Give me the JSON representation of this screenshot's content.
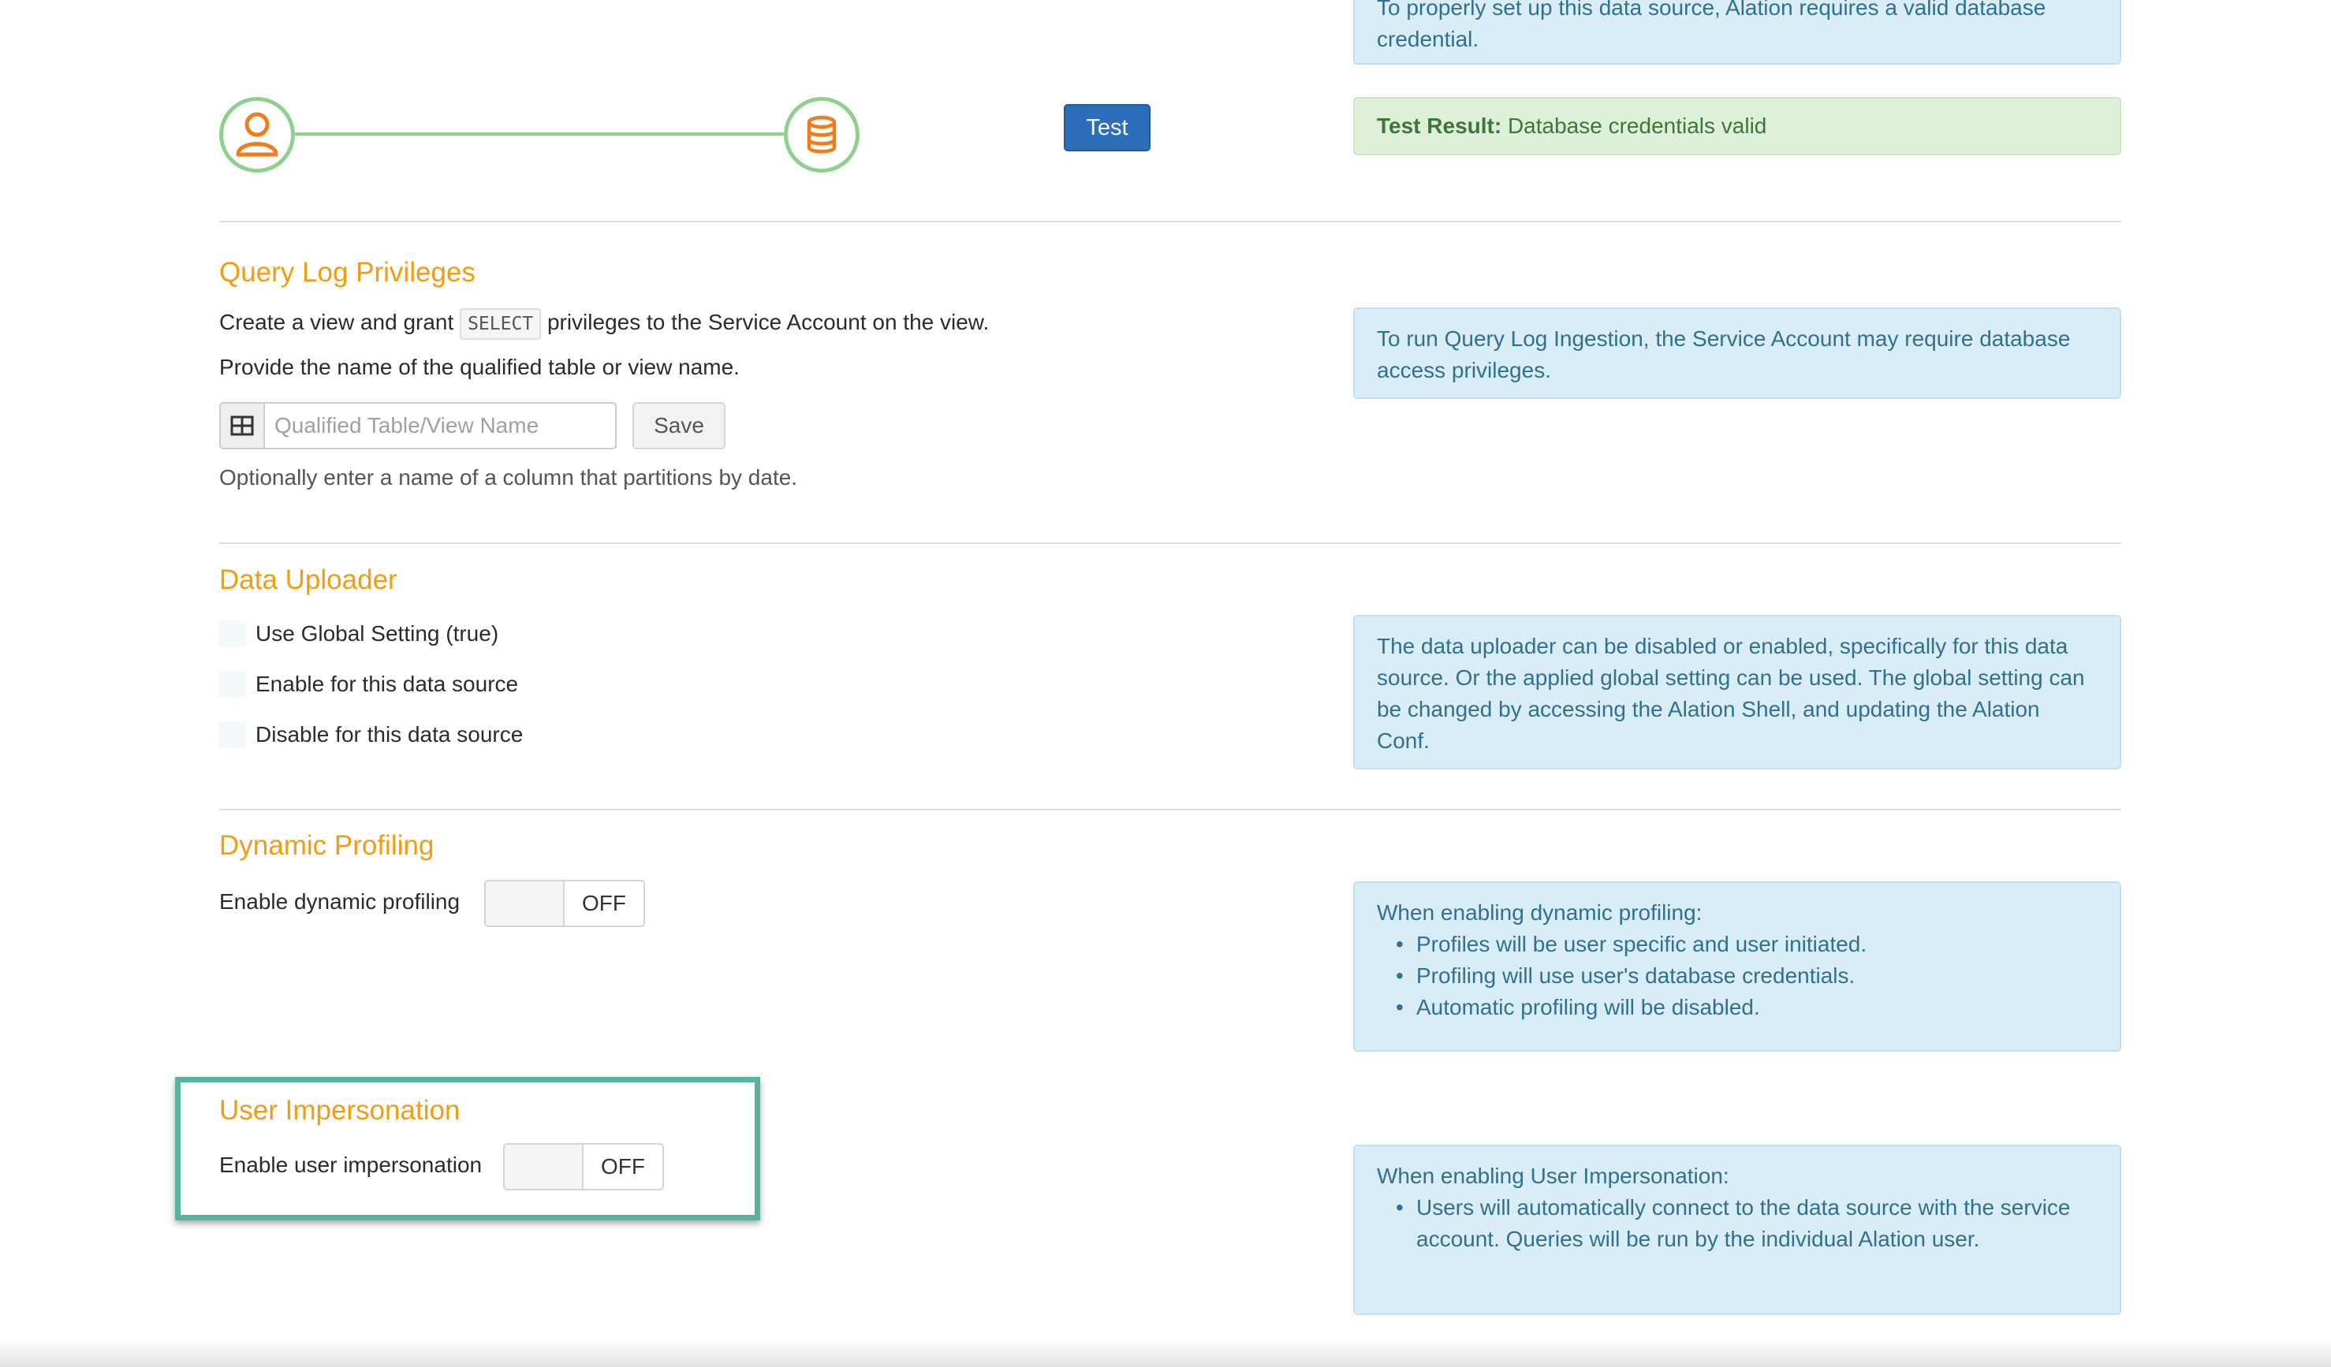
{
  "credentials": {
    "info_text": "To properly set up this data source, Alation requires a valid database credential.",
    "test_button": "Test",
    "test_result_label": "Test Result:",
    "test_result_value": "Database credentials valid"
  },
  "query_log": {
    "title": "Query Log Privileges",
    "line1_before": "Create a view and grant",
    "line1_code": "SELECT",
    "line1_after": "privileges to the Service Account on the view.",
    "line2": "Provide the name of the qualified table or view name.",
    "input_placeholder": "Qualified Table/View Name",
    "save_button": "Save",
    "partition_hint": "Optionally enter a name of a column that partitions by date.",
    "info_text": "To run Query Log Ingestion, the Service Account may require database access privileges."
  },
  "data_uploader": {
    "title": "Data Uploader",
    "options": [
      "Use Global Setting (true)",
      "Enable for this data source",
      "Disable for this data source"
    ],
    "info_text": "The data uploader can be disabled or enabled, specifically for this data source. Or the applied global setting can be used. The global setting can be changed by accessing the Alation Shell, and updating the Alation Conf."
  },
  "dynamic_profiling": {
    "title": "Dynamic Profiling",
    "label": "Enable dynamic profiling",
    "toggle_state": "OFF",
    "info_heading": "When enabling dynamic profiling:",
    "info_items": [
      "Profiles will be user specific and user initiated.",
      "Profiling will use user's database credentials.",
      "Automatic profiling will be disabled."
    ]
  },
  "user_impersonation": {
    "title": "User Impersonation",
    "label": "Enable user impersonation",
    "toggle_state": "OFF",
    "info_heading": "When enabling User Impersonation:",
    "info_items": [
      "Users will automatically connect to the data source with the service account. Queries will be run by the individual Alation user."
    ]
  },
  "colors": {
    "section_title": "#f39c12",
    "info_bg": "#d9edf7",
    "info_text": "#31708f",
    "success_bg": "#dff0d8",
    "success_text": "#3c763d",
    "primary_button": "#2d6ebb",
    "connector_green": "#8fd08f",
    "highlight_border": "#55b3a0"
  },
  "icons": {
    "user": "user-icon",
    "database": "database-icon",
    "table": "table-icon"
  }
}
